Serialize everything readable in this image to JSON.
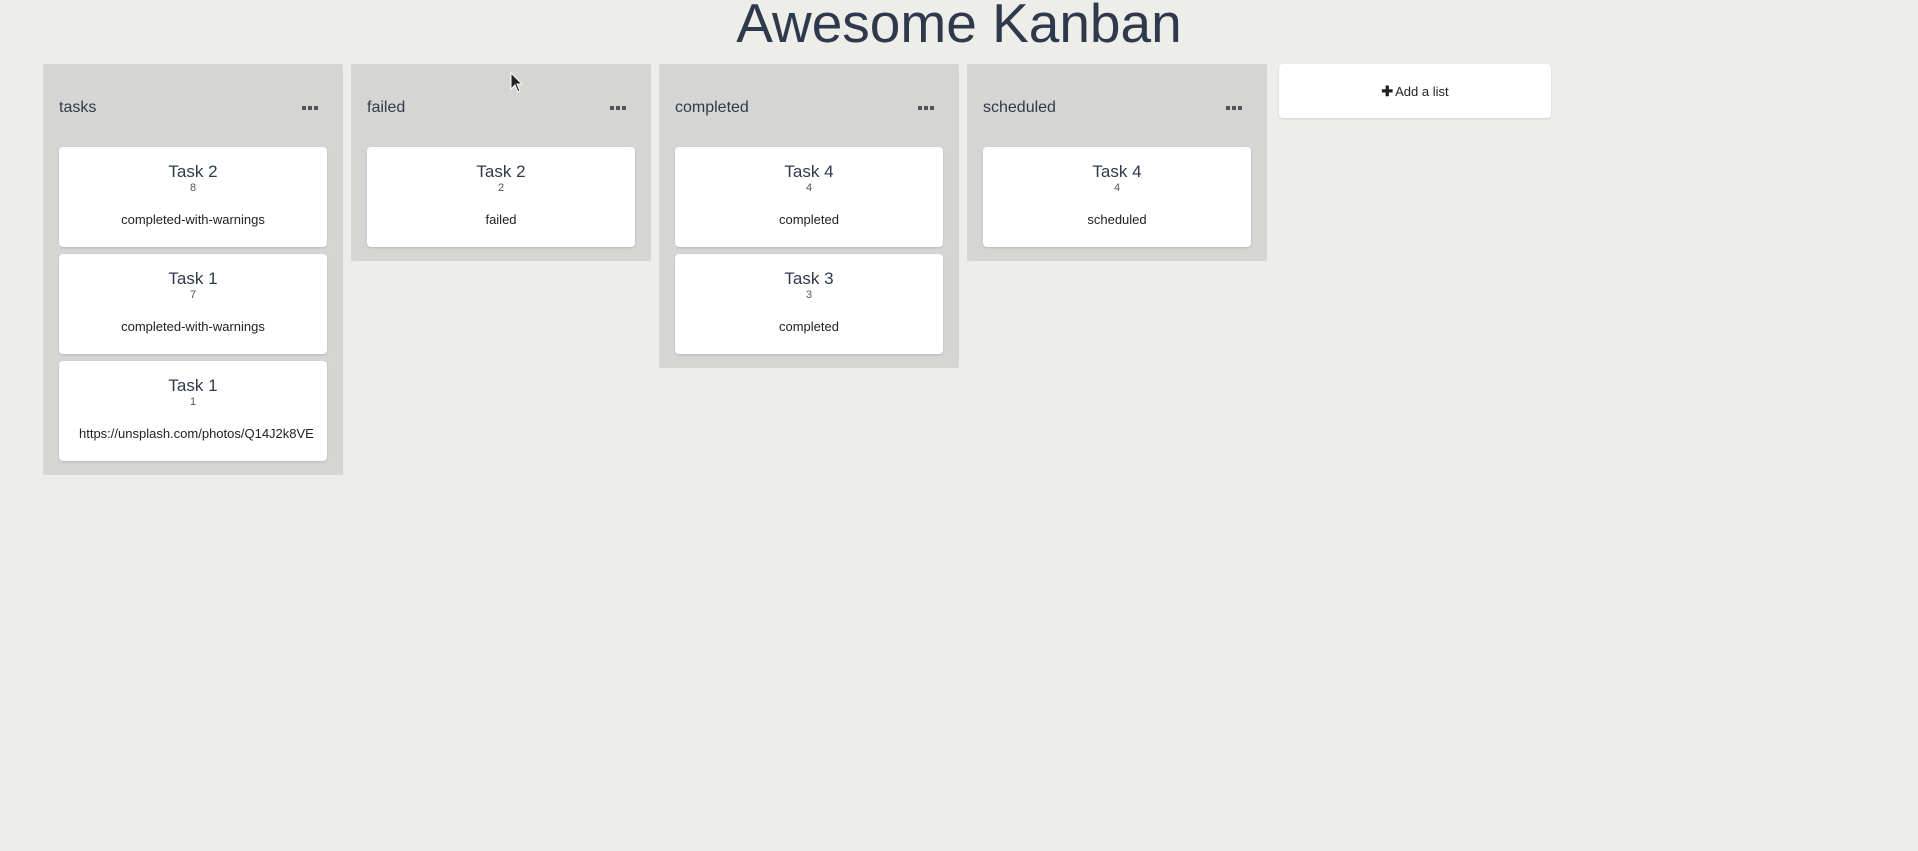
{
  "app": {
    "title": "Awesome Kanban"
  },
  "lists": [
    {
      "title": "tasks",
      "cards": [
        {
          "title": "Task 2",
          "id": "8",
          "description": "completed-with-warnings"
        },
        {
          "title": "Task 1",
          "id": "7",
          "description": "completed-with-warnings"
        },
        {
          "title": "Task 1",
          "id": "1",
          "description": "https://unsplash.com/photos/Q14J2k8VE"
        }
      ]
    },
    {
      "title": "failed",
      "cards": [
        {
          "title": "Task 2",
          "id": "2",
          "description": "failed"
        }
      ]
    },
    {
      "title": "completed",
      "cards": [
        {
          "title": "Task 4",
          "id": "4",
          "description": "completed"
        },
        {
          "title": "Task 3",
          "id": "3",
          "description": "completed"
        }
      ]
    },
    {
      "title": "scheduled",
      "cards": [
        {
          "title": "Task 4",
          "id": "4",
          "description": "scheduled"
        }
      ]
    }
  ],
  "add_list": {
    "icon": "plus-icon",
    "label": "Add a list"
  },
  "colors": {
    "background": "#ededea",
    "list_background": "#d5d5d3",
    "card_background": "#ffffff",
    "title_text": "#2e3a4c"
  }
}
